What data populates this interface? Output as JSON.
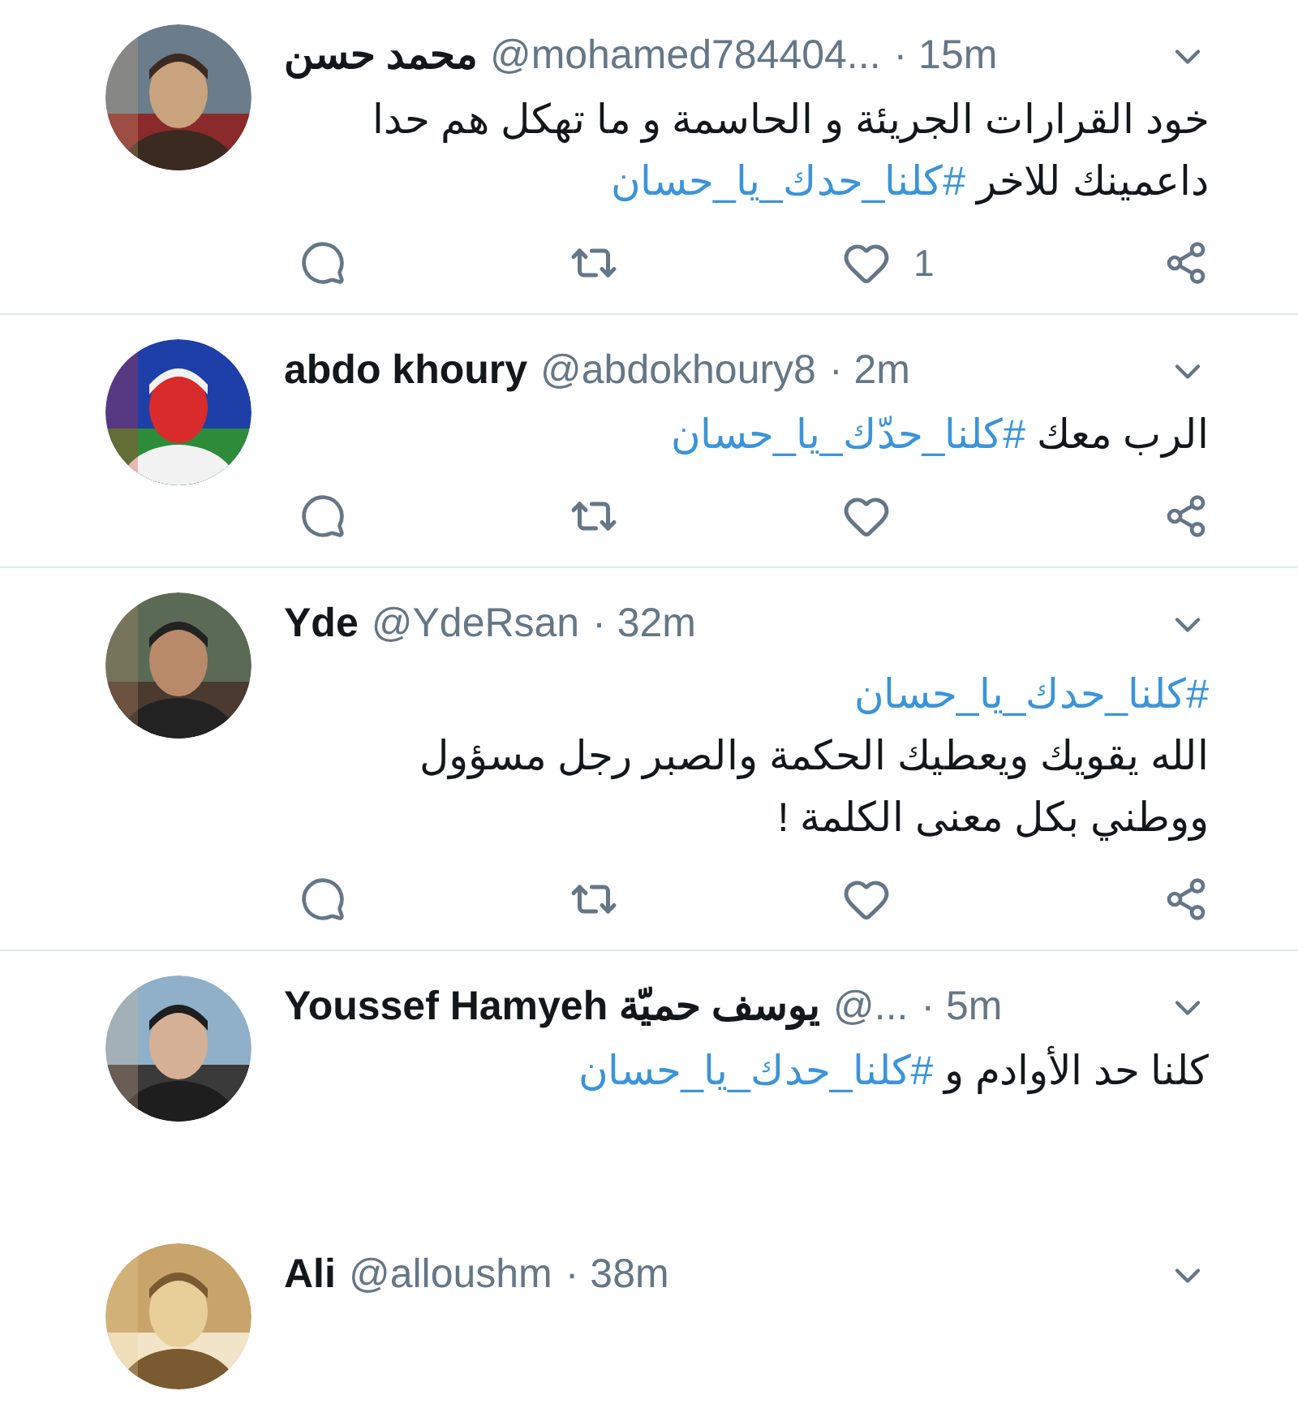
{
  "tweets": [
    {
      "name": "محمد حسن",
      "handle": "@mohamed784404...",
      "time": "· 15m",
      "lines": [
        [
          {
            "kind": "text",
            "text": "خود القرارات الجريئة و الحاسمة  و ما تهكل  هم حدا"
          }
        ],
        [
          {
            "kind": "text",
            "text": "داعمينك للاخر "
          },
          {
            "kind": "hashtag",
            "text": "#كلنا_حدك_يا_حسان"
          }
        ]
      ],
      "actions": {
        "likes": "1",
        "liked": false
      }
    },
    {
      "name": "abdo khoury",
      "handle": "@abdokhoury8",
      "time": "· 2m",
      "lines": [
        [
          {
            "kind": "text",
            "text": "الرب معك "
          },
          {
            "kind": "hashtag",
            "text": "#كلنا_حدّك_يا_حسان"
          }
        ]
      ],
      "actions": {
        "liked": false
      }
    },
    {
      "name": "Yde",
      "handle": "@YdeRsan",
      "time": "· 32m",
      "lines": [
        [
          {
            "kind": "hashtag",
            "text": "#كلنا_حدك_يا_حسان"
          }
        ],
        [
          {
            "kind": "text",
            "text": "الله يقويك ويعطيك الحكمة والصبر رجل مسؤول"
          }
        ],
        [
          {
            "kind": "text",
            "text": "ووطني بكل معنى الكلمة !"
          }
        ]
      ],
      "actions": {
        "liked": false
      }
    },
    {
      "name": "Youssef Hamyeh يوسف حميّة",
      "handle": "@...",
      "time": "· 5m",
      "lines": [
        [
          {
            "kind": "text",
            "text": "كلنا حد الأوادم و "
          },
          {
            "kind": "hashtag",
            "text": "#كلنا_حدك_يا_حسان"
          }
        ]
      ]
    },
    {
      "name": "Ali",
      "handle": "@alloushm",
      "time": "· 38m"
    }
  ]
}
